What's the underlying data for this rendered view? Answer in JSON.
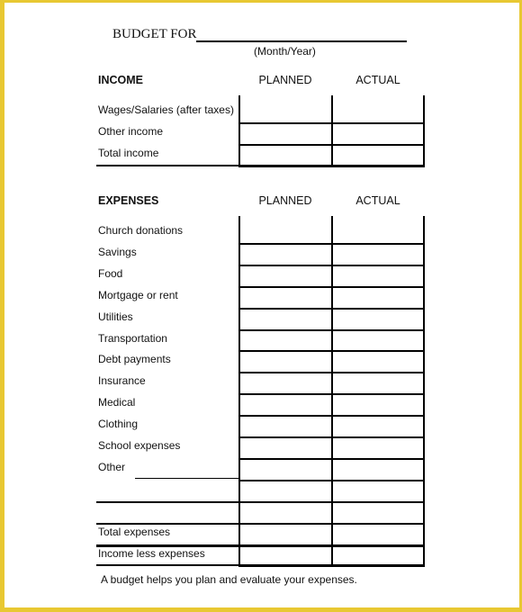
{
  "header": {
    "title": "BUDGET FOR",
    "subtitle": "(Month/Year)"
  },
  "income": {
    "heading": "INCOME",
    "columns": [
      "PLANNED",
      "ACTUAL"
    ],
    "rows": [
      {
        "label": "Wages/Salaries (after taxes)",
        "planned": "",
        "actual": ""
      },
      {
        "label": "Other income",
        "planned": "",
        "actual": ""
      },
      {
        "label": "Total income",
        "planned": "",
        "actual": ""
      }
    ]
  },
  "expenses": {
    "heading": "EXPENSES",
    "columns": [
      "PLANNED",
      "ACTUAL"
    ],
    "rows": [
      {
        "label": "Church donations",
        "planned": "",
        "actual": ""
      },
      {
        "label": "Savings",
        "planned": "",
        "actual": ""
      },
      {
        "label": "Food",
        "planned": "",
        "actual": ""
      },
      {
        "label": "Mortgage or rent",
        "planned": "",
        "actual": ""
      },
      {
        "label": "Utilities",
        "planned": "",
        "actual": ""
      },
      {
        "label": "Transportation",
        "planned": "",
        "actual": ""
      },
      {
        "label": "Debt payments",
        "planned": "",
        "actual": ""
      },
      {
        "label": "Insurance",
        "planned": "",
        "actual": ""
      },
      {
        "label": "Medical",
        "planned": "",
        "actual": ""
      },
      {
        "label": "Clothing",
        "planned": "",
        "actual": ""
      },
      {
        "label": "School expenses",
        "planned": "",
        "actual": ""
      },
      {
        "label": "Other",
        "planned": "",
        "actual": ""
      },
      {
        "label": "",
        "planned": "",
        "actual": ""
      },
      {
        "label": "",
        "planned": "",
        "actual": ""
      },
      {
        "label": "Total expenses",
        "planned": "",
        "actual": ""
      },
      {
        "label": "Income less expenses",
        "planned": "",
        "actual": ""
      }
    ]
  },
  "footer": {
    "note": "A budget helps you plan and evaluate your expenses."
  },
  "colors": {
    "frame": "#e8c832",
    "ink": "#000000"
  }
}
